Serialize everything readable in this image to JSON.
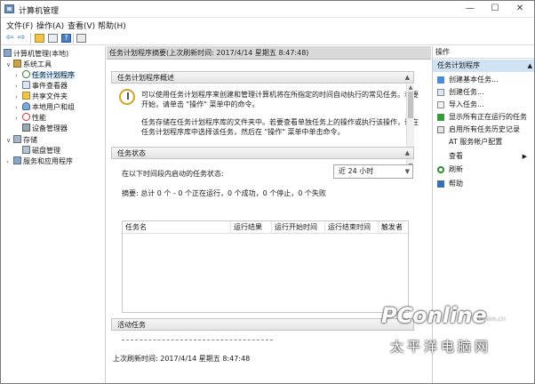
{
  "window": {
    "title": "计算机管理"
  },
  "titlebar": {
    "minimize": "—",
    "maximize": "☐",
    "close": "✕"
  },
  "menu": {
    "file": "文件(F)",
    "action": "操作(A)",
    "view": "查看(V)",
    "help": "帮助(H)"
  },
  "toolbar": {
    "back": "⇦",
    "forward": "⇨",
    "help": "?"
  },
  "tree": {
    "root": "计算机管理(本地)",
    "system_tools": "系统工具",
    "task_scheduler": "任务计划程序",
    "event_viewer": "事件查看器",
    "shared_folders": "共享文件夹",
    "local_users": "本地用户和组",
    "performance": "性能",
    "device_manager": "设备管理器",
    "storage": "存储",
    "disk_management": "磁盘管理",
    "services_apps": "服务和应用程序",
    "expanded": "∨",
    "collapsed": "›"
  },
  "main": {
    "header": "任务计划程序摘要(上次刷新时间: 2017/4/14 星期五 8:47:48)",
    "overview_title": "任务计划程序概述",
    "overview_p1_line1": "可以使用任务计划程序来创建和管理计算机将在所指定的时间自动执行的常见任务。若要",
    "overview_p1_line2": "开始，请单击 \"操作\" 菜单中的命令。",
    "overview_p2_line1": "任务存储在任务计划程序库的文件夹中。若要查看单独任务上的操作或执行该操作，请在",
    "overview_p2_line2": "任务计划程序库中选择该任务，然后在 \"操作\" 菜单中单击命令。",
    "status_title": "任务状态",
    "status_label": "在以下时间段内启动的任务状态:",
    "status_select": "近 24 小时",
    "summary": "摘要: 总计 0 个 - 0 个正在运行，0 个成功，0 个停止，0 个失败",
    "columns": [
      "任务名",
      "运行结果",
      "运行开始时间",
      "运行结束时间",
      "触发者"
    ],
    "active_title": "活动任务",
    "last_refresh": "上次刷新时间: 2017/4/14 星期五 8:47:48",
    "toggle_up": "▲",
    "toggle_down": "▼"
  },
  "actions": {
    "title": "操作",
    "section": "任务计划程序",
    "section_caret": "▲",
    "items": [
      "创建基本任务...",
      "创建任务...",
      "导入任务...",
      "显示所有正在运行的任务",
      "启用所有任务历史记录",
      "AT 服务帐户配置",
      "查看",
      "刷新",
      "帮助"
    ],
    "view_caret": "▶"
  },
  "watermark": {
    "logo": "PConline",
    "sub": "太平洋电脑网",
    "url": ".com.cn"
  },
  "colors": {
    "selection": "#cce8ff",
    "header_bg": "#d9d9d9",
    "accent": "#2a6fb5"
  }
}
